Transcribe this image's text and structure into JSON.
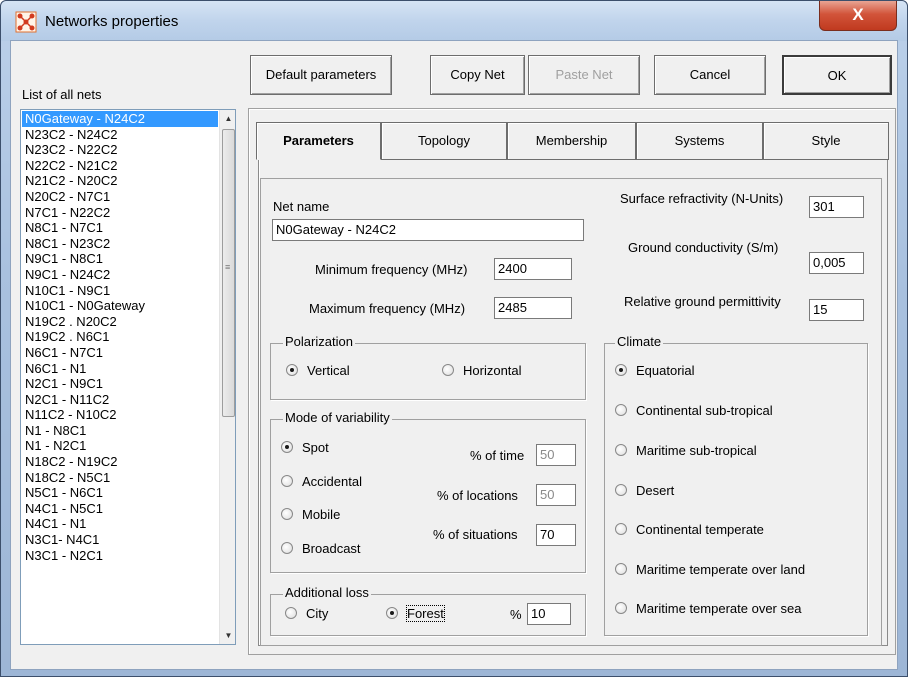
{
  "window": {
    "title": "Networks properties",
    "close_symbol": "X"
  },
  "list": {
    "label": "List of all nets",
    "items": [
      "N0Gateway - N24C2",
      "N23C2 - N24C2",
      "N23C2 - N22C2",
      "N22C2 - N21C2",
      "N21C2 - N20C2",
      "N20C2 - N7C1",
      "N7C1 - N22C2",
      "N8C1 - N7C1",
      "N8C1 - N23C2",
      "N9C1 - N8C1",
      "N9C1 - N24C2",
      "N10C1 - N9C1",
      "N10C1 - N0Gateway",
      "N19C2 . N20C2",
      "N19C2 . N6C1",
      "N6C1 - N7C1",
      "N6C1 - N1",
      "N2C1 - N9C1",
      "N2C1 - N11C2",
      "N11C2 - N10C2",
      "N1 - N8C1",
      "N1 - N2C1",
      "N18C2 - N19C2",
      "N18C2 - N5C1",
      "N5C1 - N6C1",
      "N4C1 - N5C1",
      "N4C1 - N1",
      "N3C1- N4C1",
      "N3C1 - N2C1"
    ],
    "selected_index": 0
  },
  "buttons": {
    "default": "Default parameters",
    "copy": "Copy Net",
    "paste": "Paste Net",
    "cancel": "Cancel",
    "ok": "OK"
  },
  "tabs": [
    "Parameters",
    "Topology",
    "Membership",
    "Systems",
    "Style"
  ],
  "params": {
    "net_name_label": "Net name",
    "net_name": "N0Gateway - N24C2",
    "min_freq_label": "Minimum frequency (MHz)",
    "min_freq": "2400",
    "max_freq_label": "Maximum frequency (MHz)",
    "max_freq": "2485",
    "surface_refr_label": "Surface refractivity (N-Units)",
    "surface_refr": "301",
    "ground_cond_label": "Ground conductivity (S/m)",
    "ground_cond": "0,005",
    "ground_perm_label": "Relative ground permittivity",
    "ground_perm": "15"
  },
  "polarization": {
    "legend": "Polarization",
    "vertical": "Vertical",
    "horizontal": "Horizontal",
    "selected": "vertical"
  },
  "variability": {
    "legend": "Mode of variability",
    "options": [
      "Spot",
      "Accidental",
      "Mobile",
      "Broadcast"
    ],
    "selected": "Spot",
    "time_label": "% of time",
    "time": "50",
    "locations_label": "% of locations",
    "locations": "50",
    "situations_label": "% of situations",
    "situations": "70"
  },
  "additional_loss": {
    "legend": "Additional loss",
    "city": "City",
    "forest": "Forest",
    "selected": "forest",
    "pct_label": "%",
    "pct": "10"
  },
  "climate": {
    "legend": "Climate",
    "options": [
      "Equatorial",
      "Continental sub-tropical",
      "Maritime sub-tropical",
      "Desert",
      "Continental temperate",
      "Maritime temperate over land",
      "Maritime temperate over sea"
    ],
    "selected": "Equatorial"
  }
}
